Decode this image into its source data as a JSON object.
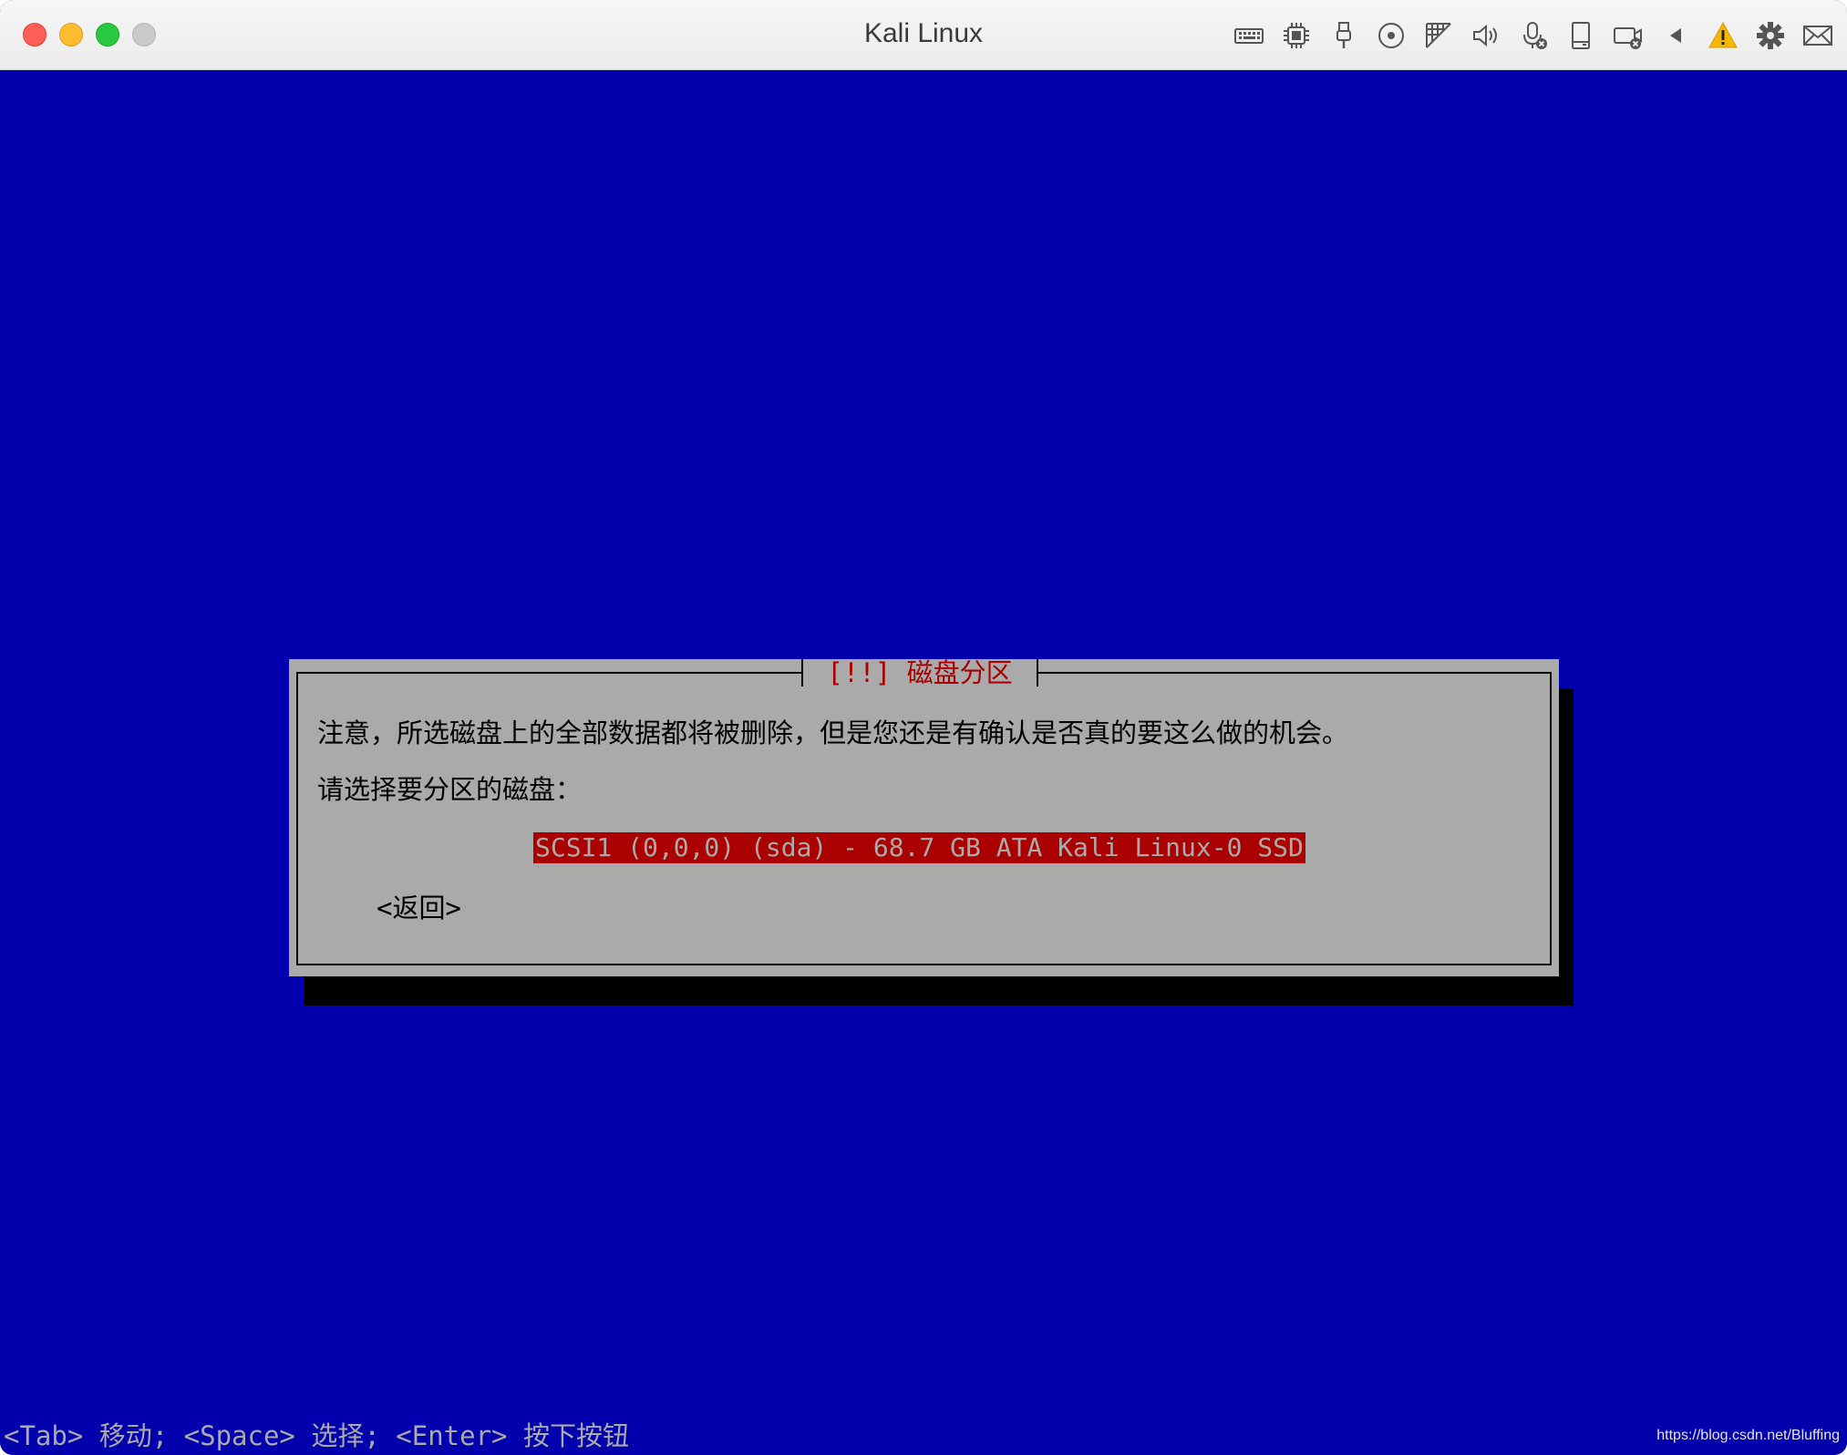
{
  "window": {
    "title": "Kali Linux"
  },
  "toolbar": {
    "icons": [
      "keyboard-icon",
      "cpu-icon",
      "usb-icon",
      "disc-icon",
      "network-icon",
      "speaker-icon",
      "microphone-icon",
      "storage-icon",
      "camera-icon",
      "back-arrow-icon",
      "warning-icon",
      "gear-icon",
      "mail-icon"
    ],
    "warning_color": "#f5b700"
  },
  "installer": {
    "background_color": "#0200AC",
    "dialog_color": "#AAAAAA",
    "accent_color": "#AA0000",
    "dialog": {
      "title": "[!!] 磁盘分区",
      "notice": "注意，所选磁盘上的全部数据都将被删除，但是您还是有确认是否真的要这么做的机会。",
      "prompt": "请选择要分区的磁盘：",
      "options": [
        "SCSI1 (0,0,0) (sda) - 68.7 GB ATA Kali Linux-0 SSD"
      ],
      "selected_option": "SCSI1 (0,0,0) (sda) - 68.7 GB ATA Kali Linux-0 SSD",
      "back_label": "<返回>"
    },
    "help_text": "<Tab> 移动; <Space> 选择; <Enter> 按下按钮"
  },
  "watermark": "https://blog.csdn.net/Bluffing"
}
